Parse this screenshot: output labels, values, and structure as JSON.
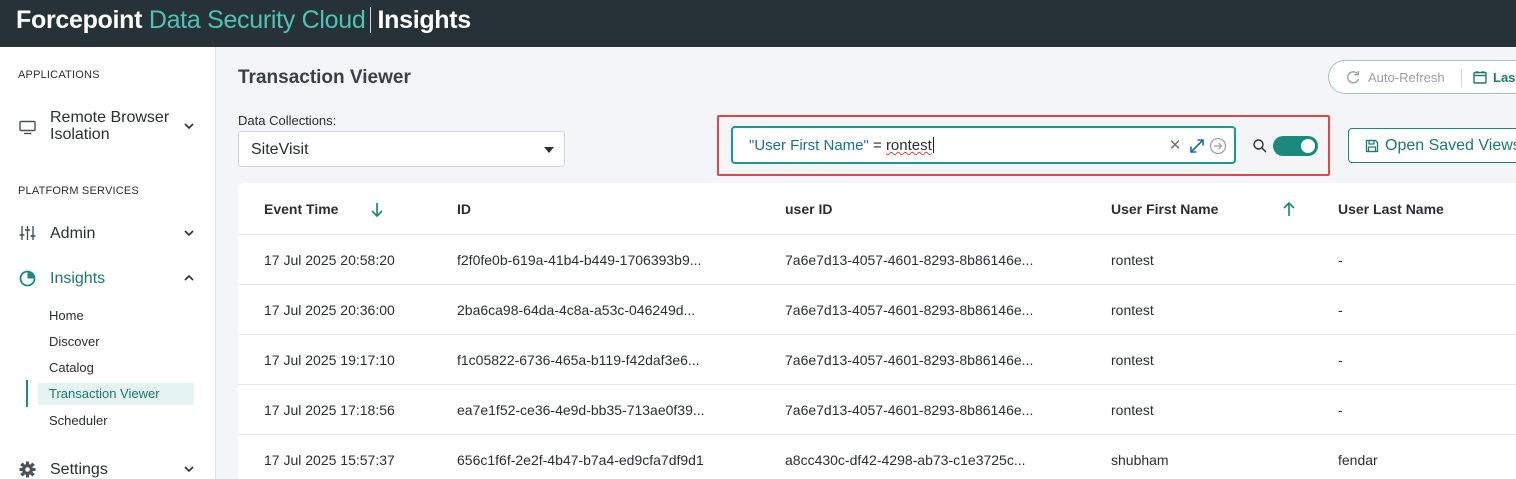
{
  "header": {
    "brand_primary": "Forcepoint",
    "brand_product": "Data Security Cloud",
    "brand_section": "Insights"
  },
  "sidebar": {
    "applications_title": "APPLICATIONS",
    "rbi_label": "Remote Browser Isolation",
    "platform_title": "PLATFORM SERVICES",
    "admin_label": "Admin",
    "insights_label": "Insights",
    "insights_sub": [
      "Home",
      "Discover",
      "Catalog",
      "Transaction Viewer",
      "Scheduler"
    ],
    "active_sub": "Transaction Viewer",
    "settings_label": "Settings",
    "accent_color": "#1a8a7c"
  },
  "main": {
    "title": "Transaction Viewer",
    "auto_refresh_label": "Auto-Refresh",
    "date_range_label": "Last",
    "data_collections_label": "Data Collections:",
    "data_collection_value": "SiteVisit",
    "query": {
      "field": "\"User First Name\"",
      "operator": " = ",
      "value": "rontest"
    },
    "filter_toggle_on": true,
    "open_saved_views_label": "Open Saved Views"
  },
  "table": {
    "columns": [
      "Event Time",
      "ID",
      "user ID",
      "User First Name",
      "User Last Name"
    ],
    "sort": {
      "event_time": "descending",
      "user_first_name": "ascending"
    },
    "rows": [
      [
        "17 Jul 2025 20:58:20",
        "f2f0fe0b-619a-41b4-b449-1706393b9...",
        "7a6e7d13-4057-4601-8293-8b86146e...",
        "rontest",
        "-"
      ],
      [
        "17 Jul 2025 20:36:00",
        "2ba6ca98-64da-4c8a-a53c-046249d...",
        "7a6e7d13-4057-4601-8293-8b86146e...",
        "rontest",
        "-"
      ],
      [
        "17 Jul 2025 19:17:10",
        "f1c05822-6736-465a-b119-f42daf3e6...",
        "7a6e7d13-4057-4601-8293-8b86146e...",
        "rontest",
        "-"
      ],
      [
        "17 Jul 2025 17:18:56",
        "ea7e1f52-ce36-4e9d-bb35-713ae0f39...",
        "7a6e7d13-4057-4601-8293-8b86146e...",
        "rontest",
        "-"
      ],
      [
        "17 Jul 2025 15:57:37",
        "656c1f6f-2e2f-4b47-b7a4-ed9cfa7df9d1",
        "a8cc430c-df42-4298-ab73-c1e3725c...",
        "shubham",
        "fendar"
      ]
    ]
  }
}
